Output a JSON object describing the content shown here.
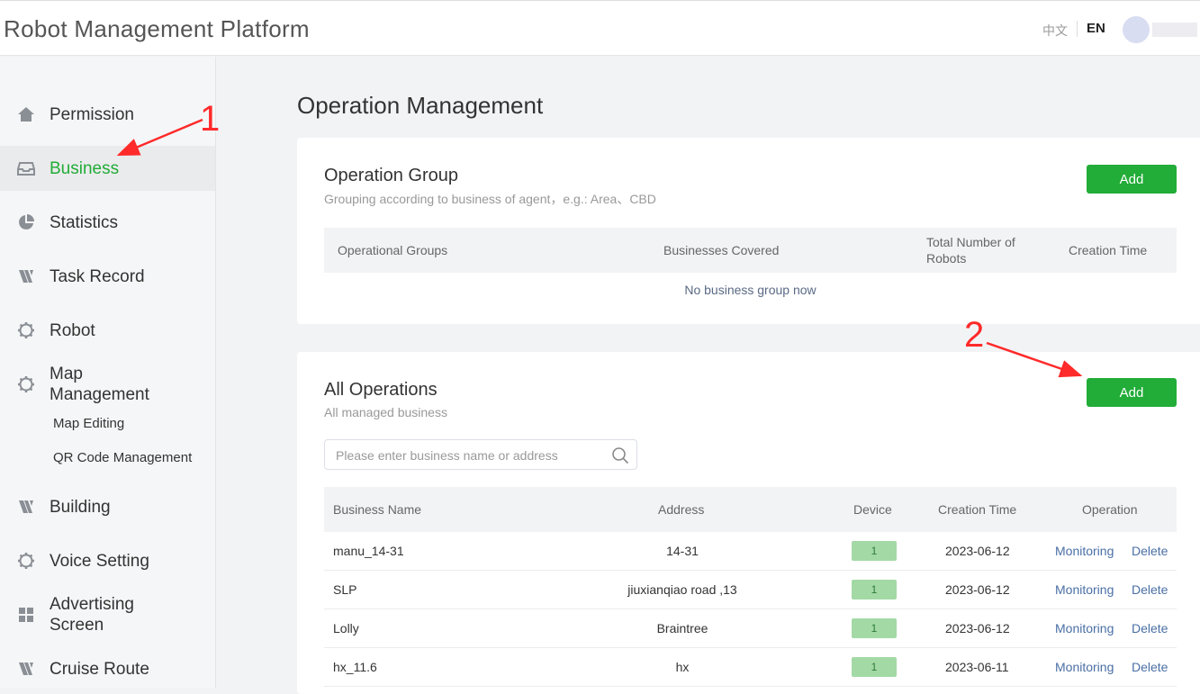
{
  "header": {
    "app_title": "Robot Management Platform",
    "lang_zh": "中文",
    "lang_en": "EN",
    "avatar_icon": "user-avatar"
  },
  "sidebar": {
    "items": [
      {
        "label": "Permission",
        "icon": "home-icon",
        "active": false
      },
      {
        "label": "Business",
        "icon": "inbox-icon",
        "active": true
      },
      {
        "label": "Statistics",
        "icon": "pie-chart-icon",
        "active": false
      },
      {
        "label": "Task Record",
        "icon": "x-logo-icon",
        "active": false
      },
      {
        "label": "Robot",
        "icon": "gear-icon",
        "active": false
      },
      {
        "label": "Map Management",
        "icon": "gear-icon",
        "active": false,
        "children": [
          "Map Editing",
          "QR Code Management"
        ]
      },
      {
        "label": "Building",
        "icon": "x-logo-icon",
        "active": false
      },
      {
        "label": "Voice Setting",
        "icon": "gear-icon",
        "active": false
      },
      {
        "label": "Advertising Screen",
        "icon": "grid-icon",
        "active": false
      },
      {
        "label": "Cruise Route",
        "icon": "x-logo-icon",
        "active": false
      }
    ]
  },
  "main": {
    "page_title": "Operation Management",
    "group_card": {
      "title": "Operation Group",
      "subtitle": "Grouping according to business of agent，e.g.: Area、CBD",
      "add_label": "Add",
      "columns": [
        "Operational Groups",
        "Businesses Covered",
        "Total Number of Robots",
        "Creation Time"
      ],
      "empty_text": "No business group now"
    },
    "ops_card": {
      "title": "All Operations",
      "subtitle": "All managed business",
      "add_label": "Add",
      "search_placeholder": "Please enter business name or address",
      "columns": [
        "Business Name",
        "Address",
        "Device",
        "Creation Time",
        "Operation"
      ],
      "rows": [
        {
          "name": "manu_14-31",
          "address": "14-31",
          "device": "1",
          "created": "2023-06-12",
          "op_monitor": "Monitoring",
          "op_delete": "Delete"
        },
        {
          "name": "SLP",
          "address": "jiuxianqiao road ,13",
          "device": "1",
          "created": "2023-06-12",
          "op_monitor": "Monitoring",
          "op_delete": "Delete"
        },
        {
          "name": "Lolly",
          "address": "Braintree",
          "device": "1",
          "created": "2023-06-12",
          "op_monitor": "Monitoring",
          "op_delete": "Delete"
        },
        {
          "name": "hx_11.6",
          "address": "hx",
          "device": "1",
          "created": "2023-06-11",
          "op_monitor": "Monitoring",
          "op_delete": "Delete"
        }
      ]
    }
  },
  "annotations": {
    "marker_1": "1",
    "marker_2": "2",
    "color": "#ff2a2a"
  },
  "colors": {
    "accent": "#22ac38",
    "link": "#4a6fa5",
    "badge": "#a3d9a5"
  }
}
